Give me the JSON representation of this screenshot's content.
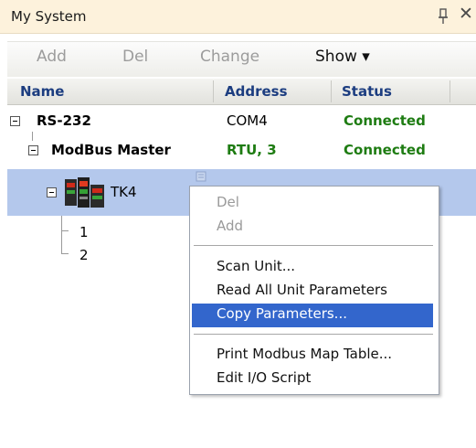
{
  "window": {
    "title": "My System",
    "pin_icon": "pin-icon",
    "close_symbol": "✕"
  },
  "toolbar": {
    "add_label": "Add",
    "del_label": "Del",
    "change_label": "Change",
    "show_label": "Show ▾"
  },
  "columns": {
    "name": "Name",
    "address": "Address",
    "status": "Status"
  },
  "tree": {
    "port": {
      "name": "RS-232",
      "address": "COM4",
      "status": "Connected"
    },
    "master": {
      "name": "ModBus Master",
      "address": "RTU, 3",
      "status": "Connected"
    },
    "device": {
      "name": "TK4"
    },
    "children": [
      "1",
      "2"
    ]
  },
  "context_menu": {
    "items": [
      {
        "label": "Del",
        "enabled": false
      },
      {
        "label": "Add",
        "enabled": false
      },
      {
        "label": "Scan Unit...",
        "enabled": true
      },
      {
        "label": "Read All Unit Parameters",
        "enabled": true
      },
      {
        "label": "Copy Parameters...",
        "enabled": true,
        "highlighted": true
      },
      {
        "label": "Print Modbus Map Table...",
        "enabled": true
      },
      {
        "label": "Edit I/O Script",
        "enabled": true
      }
    ]
  },
  "colors": {
    "title_bg": "#fdf2dc",
    "header_text": "#1c3d80",
    "status_green": "#1e7c12",
    "selection": "#b4c8ec",
    "menu_highlight": "#3366cc"
  }
}
